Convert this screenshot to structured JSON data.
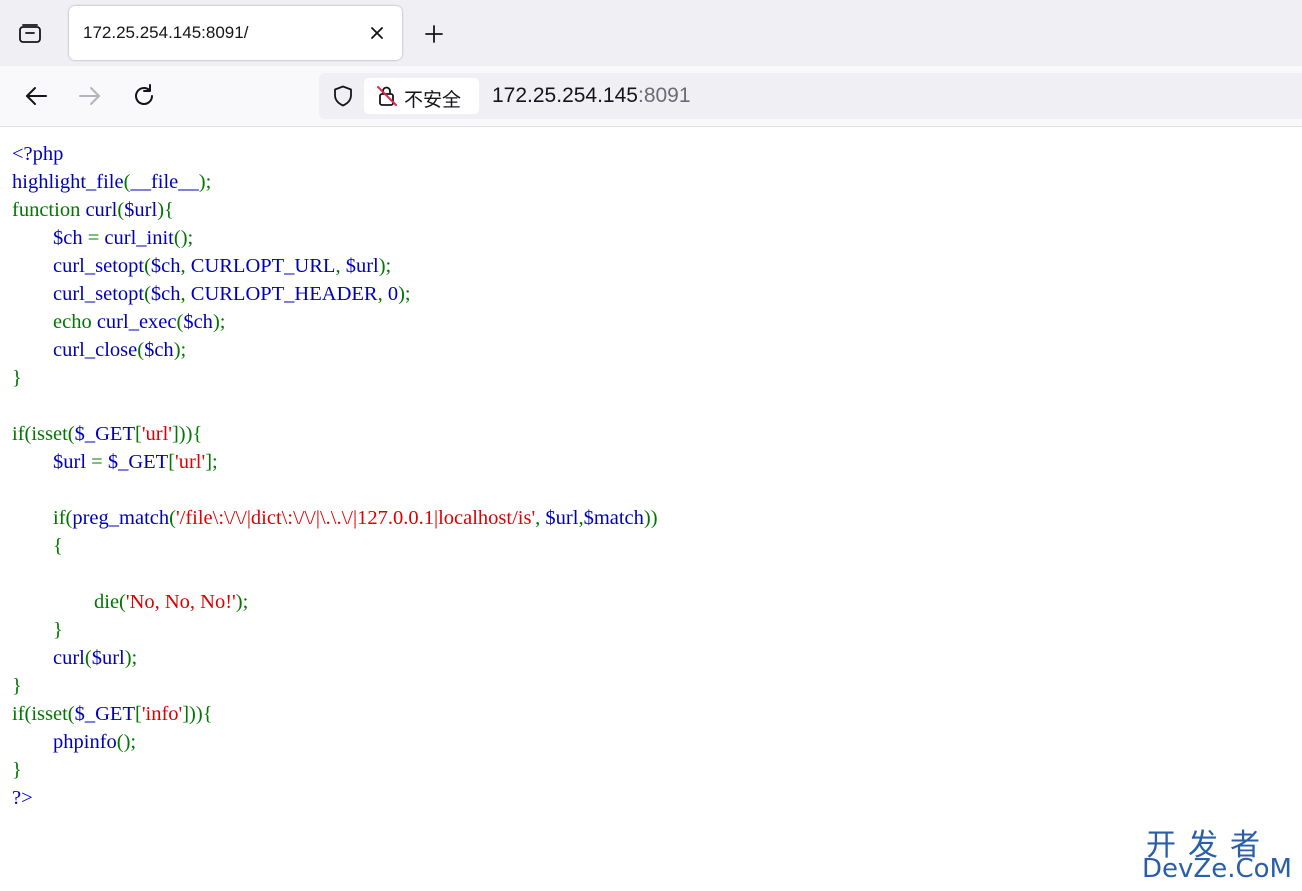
{
  "browser": {
    "tab": {
      "title": "172.25.254.145:8091/",
      "close_icon": "close-icon"
    },
    "toolbar_icons": [
      "tab-overview-icon",
      "new-tab-icon",
      "back-icon",
      "forward-icon",
      "reload-icon",
      "shield-icon",
      "insecure-lock-icon"
    ],
    "address_bar": {
      "security_label": "不安全",
      "host": "172.25.254.145",
      "port": ":8091"
    }
  },
  "code": {
    "lines": [
      [
        {
          "t": "<?php",
          "c": "def"
        }
      ],
      [
        {
          "t": "highlight_file",
          "c": "def"
        },
        {
          "t": "(",
          "c": "kw"
        },
        {
          "t": "__file__",
          "c": "def"
        },
        {
          "t": ");",
          "c": "kw"
        }
      ],
      [
        {
          "t": "function ",
          "c": "kw"
        },
        {
          "t": "curl",
          "c": "def"
        },
        {
          "t": "(",
          "c": "kw"
        },
        {
          "t": "$url",
          "c": "def"
        },
        {
          "t": "){",
          "c": "kw"
        }
      ],
      [
        {
          "t": "        $ch ",
          "c": "def"
        },
        {
          "t": "= ",
          "c": "kw"
        },
        {
          "t": "curl_init",
          "c": "def"
        },
        {
          "t": "();",
          "c": "kw"
        }
      ],
      [
        {
          "t": "        curl_setopt",
          "c": "def"
        },
        {
          "t": "(",
          "c": "kw"
        },
        {
          "t": "$ch",
          "c": "def"
        },
        {
          "t": ", ",
          "c": "kw"
        },
        {
          "t": "CURLOPT_URL",
          "c": "def"
        },
        {
          "t": ", ",
          "c": "kw"
        },
        {
          "t": "$url",
          "c": "def"
        },
        {
          "t": ");",
          "c": "kw"
        }
      ],
      [
        {
          "t": "        curl_setopt",
          "c": "def"
        },
        {
          "t": "(",
          "c": "kw"
        },
        {
          "t": "$ch",
          "c": "def"
        },
        {
          "t": ", ",
          "c": "kw"
        },
        {
          "t": "CURLOPT_HEADER",
          "c": "def"
        },
        {
          "t": ", ",
          "c": "kw"
        },
        {
          "t": "0",
          "c": "def"
        },
        {
          "t": ");",
          "c": "kw"
        }
      ],
      [
        {
          "t": "        echo ",
          "c": "kw"
        },
        {
          "t": "curl_exec",
          "c": "def"
        },
        {
          "t": "(",
          "c": "kw"
        },
        {
          "t": "$ch",
          "c": "def"
        },
        {
          "t": ");",
          "c": "kw"
        }
      ],
      [
        {
          "t": "        curl_close",
          "c": "def"
        },
        {
          "t": "(",
          "c": "kw"
        },
        {
          "t": "$ch",
          "c": "def"
        },
        {
          "t": ");",
          "c": "kw"
        }
      ],
      [
        {
          "t": "}",
          "c": "kw"
        }
      ],
      [],
      [
        {
          "t": "if(isset(",
          "c": "kw"
        },
        {
          "t": "$_GET",
          "c": "def"
        },
        {
          "t": "[",
          "c": "kw"
        },
        {
          "t": "'url'",
          "c": "str"
        },
        {
          "t": "])){",
          "c": "kw"
        }
      ],
      [
        {
          "t": "        $url ",
          "c": "def"
        },
        {
          "t": "= ",
          "c": "kw"
        },
        {
          "t": "$_GET",
          "c": "def"
        },
        {
          "t": "[",
          "c": "kw"
        },
        {
          "t": "'url'",
          "c": "str"
        },
        {
          "t": "];",
          "c": "kw"
        }
      ],
      [],
      [
        {
          "t": "        if(",
          "c": "kw"
        },
        {
          "t": "preg_match",
          "c": "def"
        },
        {
          "t": "(",
          "c": "kw"
        },
        {
          "t": "'/file\\:\\/\\/|dict\\:\\/\\/|\\.\\.\\/|127.0.0.1|localhost/is'",
          "c": "str"
        },
        {
          "t": ", ",
          "c": "kw"
        },
        {
          "t": "$url",
          "c": "def"
        },
        {
          "t": ",",
          "c": "kw"
        },
        {
          "t": "$match",
          "c": "def"
        },
        {
          "t": "))",
          "c": "kw"
        }
      ],
      [
        {
          "t": "        {",
          "c": "kw"
        }
      ],
      [],
      [
        {
          "t": "                die(",
          "c": "kw"
        },
        {
          "t": "'No, No, No!'",
          "c": "str"
        },
        {
          "t": ");",
          "c": "kw"
        }
      ],
      [
        {
          "t": "        }",
          "c": "kw"
        }
      ],
      [
        {
          "t": "        curl",
          "c": "def"
        },
        {
          "t": "(",
          "c": "kw"
        },
        {
          "t": "$url",
          "c": "def"
        },
        {
          "t": ");",
          "c": "kw"
        }
      ],
      [
        {
          "t": "}",
          "c": "kw"
        }
      ],
      [
        {
          "t": "if(isset(",
          "c": "kw"
        },
        {
          "t": "$_GET",
          "c": "def"
        },
        {
          "t": "[",
          "c": "kw"
        },
        {
          "t": "'info'",
          "c": "str"
        },
        {
          "t": "])){",
          "c": "kw"
        }
      ],
      [
        {
          "t": "        phpinfo",
          "c": "def"
        },
        {
          "t": "();",
          "c": "kw"
        }
      ],
      [
        {
          "t": "}",
          "c": "kw"
        }
      ],
      [
        {
          "t": "?>",
          "c": "def"
        }
      ]
    ]
  },
  "watermark": {
    "top": "开发者",
    "bottom": "DevZe.CoM"
  },
  "colors": {
    "php_default": "#0000bb",
    "php_keyword": "#007700",
    "php_string": "#dd0000",
    "watermark": "#2a5fa8"
  }
}
